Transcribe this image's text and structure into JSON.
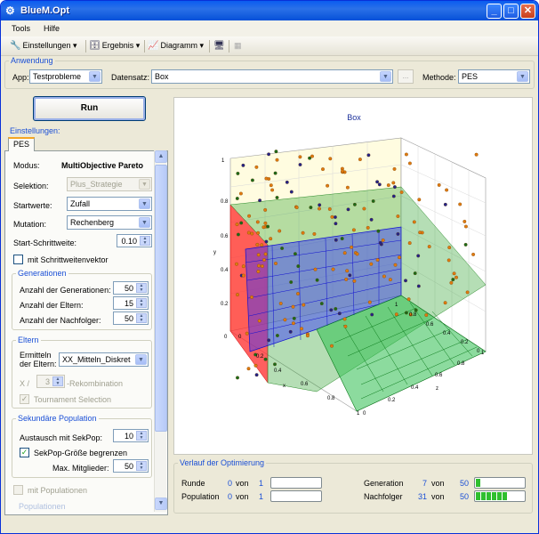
{
  "window": {
    "title": "BlueM.Opt",
    "min": "_",
    "max": "□",
    "close": "✕"
  },
  "menu": {
    "tools": "Tools",
    "hilfe": "Hilfe"
  },
  "toolbar": {
    "einstellungen": "Einstellungen",
    "ergebnis": "Ergebnis",
    "diagramm": "Diagramm"
  },
  "anwendung": {
    "legend": "Anwendung",
    "app_label": "App:",
    "app_value": "Testprobleme",
    "datensatz_label": "Datensatz:",
    "datensatz_value": "Box",
    "browse": "...",
    "methode_label": "Methode:",
    "methode_value": "PES"
  },
  "run": "Run",
  "einstellungen": {
    "legend": "Einstellungen:",
    "tab": "PES",
    "modus_label": "Modus:",
    "modus_value": "MultiObjective Pareto",
    "selektion_label": "Selektion:",
    "selektion_value": "Plus_Strategie",
    "startwerte_label": "Startwerte:",
    "startwerte_value": "Zufall",
    "mutation_label": "Mutation:",
    "mutation_value": "Rechenberg",
    "schrittweite_label": "Start-Schrittweite:",
    "schrittweite_value": "0.10",
    "schrittweitenvektor": "mit Schrittweitenvektor",
    "generationen": {
      "legend": "Generationen",
      "gen_label": "Anzahl der Generationen:",
      "gen_value": "50",
      "eltern_label": "Anzahl der Eltern:",
      "eltern_value": "15",
      "nach_label": "Anzahl der Nachfolger:",
      "nach_value": "50"
    },
    "eltern": {
      "legend": "Eltern",
      "ermitteln_label1": "Ermitteln",
      "ermitteln_label2": "der Eltern:",
      "ermitteln_value": "XX_Mitteln_Diskret",
      "x_label": "X /",
      "x_value": "3",
      "rekomb": "-Rekombination",
      "tournament": "Tournament Selection"
    },
    "sekpop": {
      "legend": "Sekundäre Population",
      "austausch_label": "Austausch mit SekPop:",
      "austausch_value": "10",
      "begrenzen": "SekPop-Größe begrenzen",
      "max_label": "Max. Mitglieder:",
      "max_value": "50"
    },
    "populationen_chk": "mit Populationen",
    "populationen_legend": "Populationen"
  },
  "chart": {
    "title": "Box",
    "y_ticks": [
      "1",
      "0.8",
      "0.6",
      "0.4",
      "0.2",
      "0"
    ],
    "x_ticks": [
      "0",
      "0.2",
      "0.4",
      "0.6",
      "0.8",
      "1"
    ],
    "z_ticks": [
      "0",
      "0.2",
      "0.4",
      "0.6",
      "0.8",
      "1"
    ],
    "rx_ticks": [
      "0",
      "0.2",
      "0.4",
      "0.6",
      "0.8",
      "1"
    ],
    "axis_y": "y",
    "axis_x": "x",
    "axis_z": "z"
  },
  "verlauf": {
    "legend": "Verlauf der Optimierung",
    "runde_label": "Runde",
    "runde_cur": "0",
    "runde_von": "von",
    "runde_max": "1",
    "pop_label": "Population",
    "pop_cur": "0",
    "pop_von": "von",
    "pop_max": "1",
    "gen_label": "Generation",
    "gen_cur": "7",
    "gen_von": "von",
    "gen_max": "50",
    "gen_progress": 0.14,
    "nach_label": "Nachfolger",
    "nach_cur": "31",
    "nach_von": "von",
    "nach_max": "50",
    "nach_progress": 0.62
  }
}
